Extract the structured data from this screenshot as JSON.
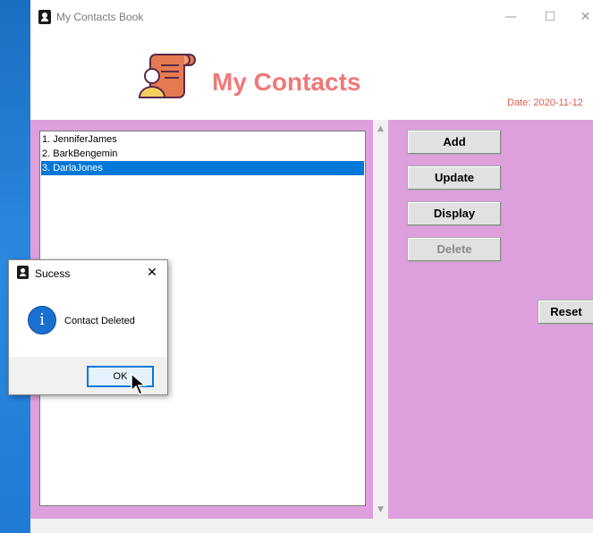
{
  "window": {
    "title": "My Contacts Book",
    "controls": {
      "minimize": "—",
      "maximize": "☐",
      "close": "✕"
    }
  },
  "header": {
    "heading": "My Contacts",
    "date": "Date: 2020-11-12",
    "logo_icon": "contact-scroll-icon"
  },
  "contacts": {
    "items": [
      {
        "label": "1. JenniferJames",
        "selected": false
      },
      {
        "label": "2. BarkBengemin",
        "selected": false
      },
      {
        "label": "3. DarlaJones",
        "selected": true
      }
    ]
  },
  "buttons": {
    "add": "Add",
    "update": "Update",
    "display": "Display",
    "delete": "Delete",
    "reset": "Reset"
  },
  "dialog": {
    "title": "Sucess",
    "message": "Contact Deleted",
    "ok_label": "OK",
    "icon": "info-icon",
    "close_glyph": "✕"
  },
  "colors": {
    "panel_bg": "#dda0dd",
    "heading": "#f07878",
    "date": "#e05a50",
    "selection": "#0078d7"
  }
}
